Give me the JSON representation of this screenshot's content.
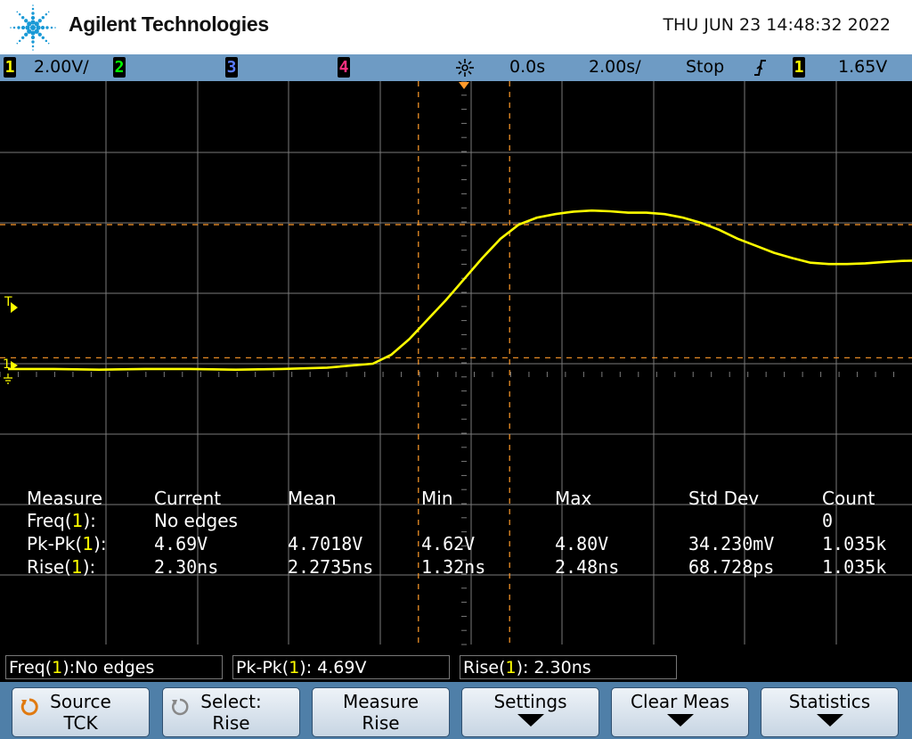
{
  "header": {
    "brand": "Agilent Technologies",
    "datetime": "THU JUN 23 14:48:32 2022"
  },
  "statusbar": {
    "ch1_num": "1",
    "ch1_scale": "2.00V/",
    "ch2_num": "2",
    "ch3_num": "3",
    "ch4_num": "4",
    "delay": "0.0s",
    "timebase": "2.00s/",
    "run_state": "Stop",
    "trig_source": "1",
    "trig_level": "1.65V"
  },
  "colors": {
    "ch1": "#ffff00",
    "ch2": "#00ff00",
    "ch3": "#4060ff",
    "ch4": "#ff3080",
    "cursor": "#ff9a2a",
    "grid": "#7a7a7a",
    "statusbar": "#6e9bc4",
    "softkeys": "#4f7fa8"
  },
  "screen": {
    "trigger_marker": "T",
    "ch1_marker": "1"
  },
  "waveform": {
    "channel": "1",
    "time_divisions": [
      -5,
      -4,
      -3,
      -2,
      -1,
      0,
      1,
      2,
      3,
      4,
      5
    ],
    "volts_per_div": 2.0,
    "points": [
      [
        -5.0,
        -0.1
      ],
      [
        -4.5,
        -0.1
      ],
      [
        -4.0,
        -0.12
      ],
      [
        -3.5,
        -0.1
      ],
      [
        -3.0,
        -0.1
      ],
      [
        -2.5,
        -0.12
      ],
      [
        -2.0,
        -0.1
      ],
      [
        -1.5,
        -0.06
      ],
      [
        -1.0,
        0.05
      ],
      [
        -0.8,
        0.3
      ],
      [
        -0.6,
        0.75
      ],
      [
        -0.4,
        1.3
      ],
      [
        -0.2,
        1.85
      ],
      [
        0.0,
        2.45
      ],
      [
        0.2,
        3.05
      ],
      [
        0.4,
        3.6
      ],
      [
        0.6,
        4.0
      ],
      [
        0.8,
        4.2
      ],
      [
        1.0,
        4.3
      ],
      [
        1.2,
        4.37
      ],
      [
        1.4,
        4.4
      ],
      [
        1.6,
        4.38
      ],
      [
        1.8,
        4.34
      ],
      [
        2.0,
        4.34
      ],
      [
        2.2,
        4.3
      ],
      [
        2.4,
        4.2
      ],
      [
        2.6,
        4.05
      ],
      [
        2.8,
        3.85
      ],
      [
        3.0,
        3.6
      ],
      [
        3.2,
        3.4
      ],
      [
        3.4,
        3.2
      ],
      [
        3.6,
        3.05
      ],
      [
        3.8,
        2.92
      ],
      [
        4.0,
        2.88
      ],
      [
        4.2,
        2.88
      ],
      [
        4.4,
        2.9
      ],
      [
        4.6,
        2.94
      ],
      [
        4.8,
        2.97
      ],
      [
        5.0,
        2.98
      ]
    ],
    "cursor_x": [
      -0.5,
      0.5
    ],
    "cursor_y": [
      0.22,
      4.0
    ]
  },
  "measurements": {
    "headers": [
      "Measure",
      "Current",
      "Mean",
      "Min",
      "Max",
      "Std Dev",
      "Count"
    ],
    "rows": [
      {
        "name_pre": "Freq(",
        "ch": "1",
        "name_post": "):",
        "current": "No edges",
        "mean": "",
        "min": "",
        "max": "",
        "std": "",
        "count": "0"
      },
      {
        "name_pre": "Pk-Pk(",
        "ch": "1",
        "name_post": "):",
        "current": "4.69V",
        "mean": "4.7018V",
        "min": "4.62V",
        "max": "4.80V",
        "std": "34.230mV",
        "count": "1.035k"
      },
      {
        "name_pre": "Rise(",
        "ch": "1",
        "name_post": "):",
        "current": "2.30ns",
        "mean": "2.2735ns",
        "min": "1.32ns",
        "max": "2.48ns",
        "std": "68.728ps",
        "count": "1.035k"
      }
    ]
  },
  "readouts": {
    "freq_pre": "Freq(",
    "freq_ch": "1",
    "freq_post": "):No edges",
    "pkpk_pre": "Pk-Pk(",
    "pkpk_ch": "1",
    "pkpk_post": "): 4.69V",
    "rise_pre": "Rise(",
    "rise_ch": "1",
    "rise_post": "): 2.30ns"
  },
  "softkeys": {
    "source_l1": "Source",
    "source_l2": "TCK",
    "select_l1": "Select:",
    "select_l2": "Rise",
    "measure_l1": "Measure",
    "measure_l2": "Rise",
    "settings_l1": "Settings",
    "clear_l1": "Clear Meas",
    "statistics_l1": "Statistics"
  }
}
